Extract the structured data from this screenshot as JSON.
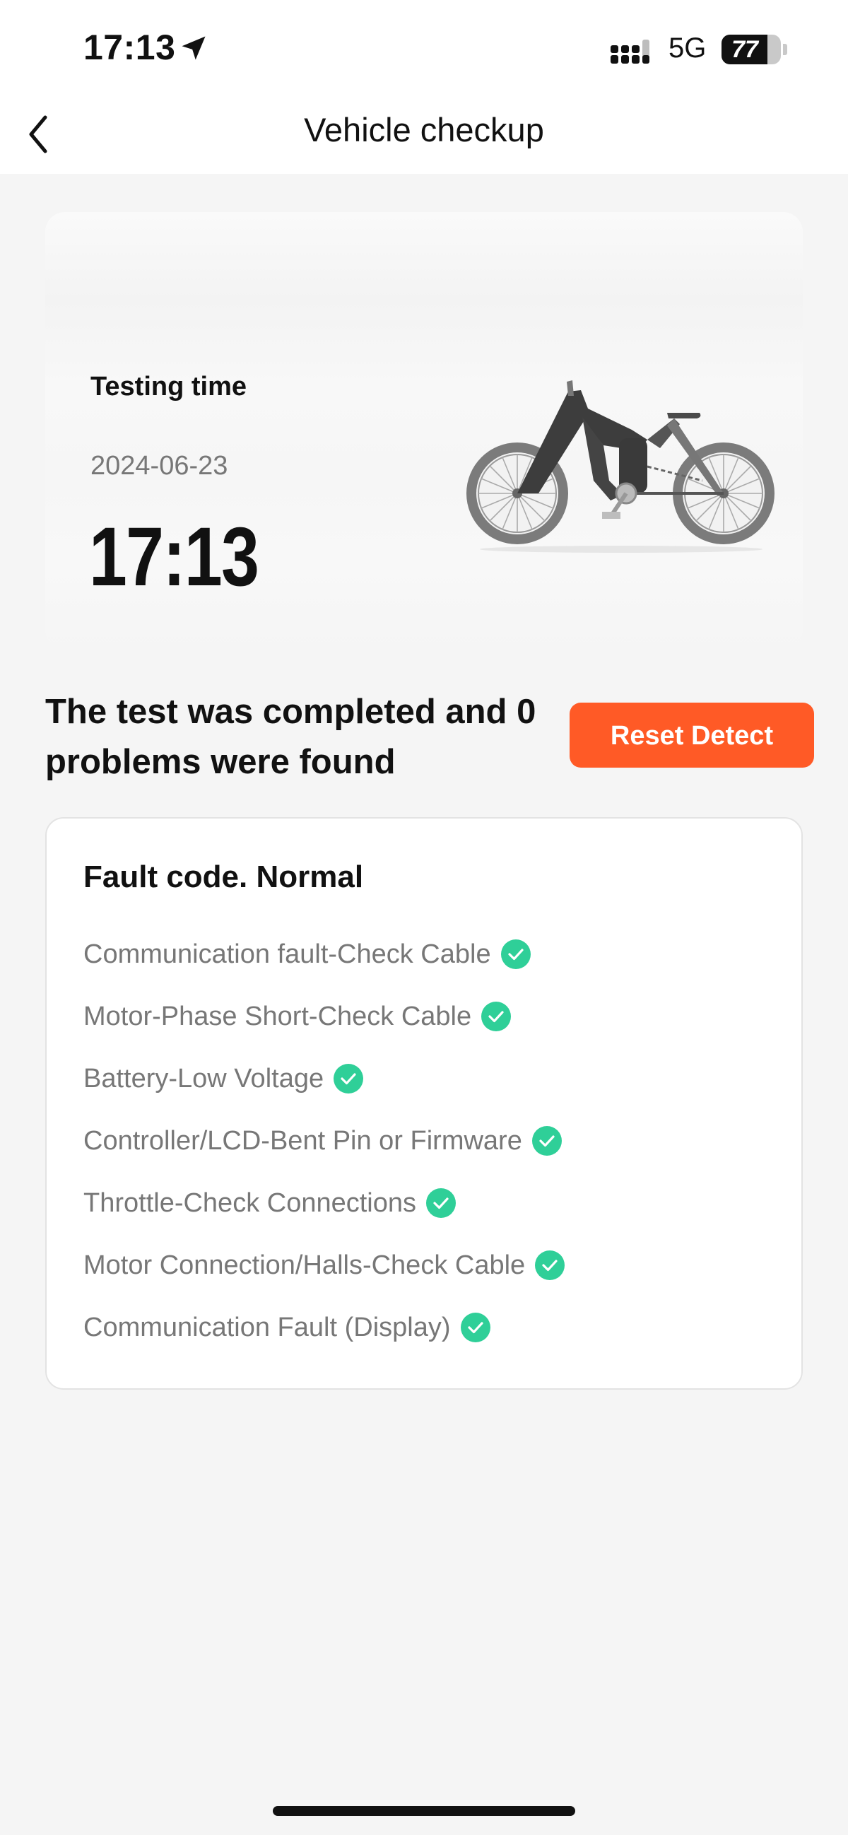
{
  "status_bar": {
    "time": "17:13",
    "network": "5G",
    "battery_level": "77",
    "battery_fraction": 0.77
  },
  "nav": {
    "title": "Vehicle checkup",
    "back_icon": "chevron-left-icon"
  },
  "test_info": {
    "label": "Testing time",
    "date": "2024-06-23",
    "clock": "17:13",
    "image": "ebike-illustration"
  },
  "result": {
    "summary": "The test was completed and 0 problems were found",
    "reset_button": "Reset Detect"
  },
  "fault_card": {
    "title": "Fault code. Normal",
    "items": [
      {
        "label": "Communication fault-Check Cable",
        "status": "ok"
      },
      {
        "label": "Motor-Phase Short-Check Cable",
        "status": "ok"
      },
      {
        "label": "Battery-Low Voltage",
        "status": "ok"
      },
      {
        "label": "Controller/LCD-Bent Pin or Firmware",
        "status": "ok"
      },
      {
        "label": "Throttle-Check Connections",
        "status": "ok"
      },
      {
        "label": "Motor Connection/Halls-Check Cable",
        "status": "ok"
      },
      {
        "label": "Communication Fault (Display)",
        "status": "ok"
      }
    ],
    "check_icon": "check-circle-icon"
  },
  "colors": {
    "accent": "#ff5a26",
    "ok_green": "#2fcf98",
    "background": "#f5f5f5"
  }
}
